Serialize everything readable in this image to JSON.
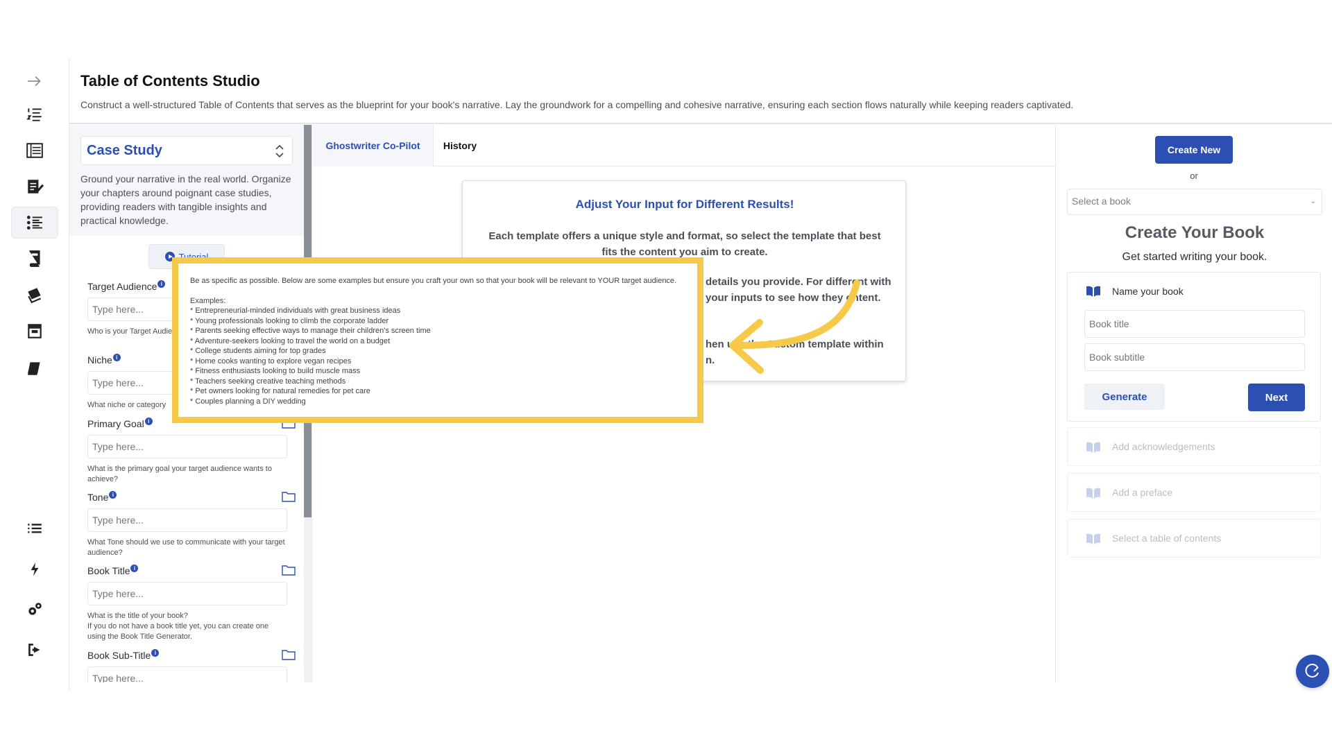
{
  "header": {
    "title": "Table of Contents Studio",
    "description": "Construct a well-structured Table of Contents that serves as the blueprint for your book's narrative. Lay the groundwork for a compelling and cohesive narrative, ensuring each section flows naturally while keeping readers captivated."
  },
  "rail": {
    "icons": [
      "arrow-right-icon",
      "numbered-list-icon",
      "table-list-icon",
      "edit-document-icon",
      "toc-list-icon",
      "book-open-icon",
      "books-icon",
      "archive-icon",
      "book-icon",
      "list-icon",
      "bolt-icon",
      "settings-icon",
      "logout-icon"
    ]
  },
  "template": {
    "selected": "Case Study",
    "description": "Ground your narrative in the real world. Organize your chapters around poignant case studies, providing readers with tangible insights and practical knowledge.",
    "tutorial_label": "Tutorial",
    "fields": [
      {
        "label": "Target Audience",
        "placeholder": "Type here...",
        "help": "Who is your Target Audience for this book for?"
      },
      {
        "label": "Niche",
        "placeholder": "Type here...",
        "help": "What niche or category"
      },
      {
        "label": "Primary Goal",
        "placeholder": "Type here...",
        "help": "What is the primary goal your target audience wants to achieve?"
      },
      {
        "label": "Tone",
        "placeholder": "Type here...",
        "help": "What Tone should we use to communicate with your target audience?"
      },
      {
        "label": "Book Title",
        "placeholder": "Type here...",
        "help": "What is the title of your book?\nIf you do not have a book title yet, you can create one using the Book Title Generator."
      },
      {
        "label": "Book Sub-Title",
        "placeholder": "Type here...",
        "help": ""
      }
    ]
  },
  "tabs": {
    "copilot": "Ghostwriter Co-Pilot",
    "history": "History"
  },
  "hint": {
    "title": "Adjust Your Input for Different Results!",
    "p1": "Each template offers a unique style and format, so select the template that best fits the content you aim to create.",
    "p2_visible": "details you provide. For different with your inputs to see how they ontent.",
    "p3_visible": "hen use the Custom template within n."
  },
  "tooltip": {
    "intro": "Be as specific as possible. Below are some examples but ensure you craft your own so that your book will be relevant to YOUR target audience.",
    "examples_heading": "Examples:",
    "examples": [
      "* Entrepreneurial-minded individuals with great business ideas",
      "* Young professionals looking to climb the corporate ladder",
      "* Parents seeking effective ways to manage their children's screen time",
      "* Adventure-seekers looking to travel the world on a budget",
      "* College students aiming for top grades",
      "* Home cooks wanting to explore vegan recipes",
      "* Fitness enthusiasts looking to build muscle mass",
      "* Teachers seeking creative teaching methods",
      "* Pet owners looking for natural remedies for pet care",
      "* Couples planning a DIY wedding"
    ],
    "highlight_color": "#f7c948"
  },
  "right": {
    "create_new": "Create New",
    "or": "or",
    "select_placeholder": "Select a book",
    "title": "Create Your Book",
    "subtitle": "Get started writing your book.",
    "step1": {
      "label": "Name your book",
      "title_placeholder": "Book title",
      "subtitle_placeholder": "Book subtitle",
      "generate": "Generate",
      "next": "Next"
    },
    "steps_disabled": [
      "Add acknowledgements",
      "Add a preface",
      "Select a table of contents"
    ]
  },
  "colors": {
    "accent": "#2b4fb3",
    "highlight": "#f7c948"
  }
}
